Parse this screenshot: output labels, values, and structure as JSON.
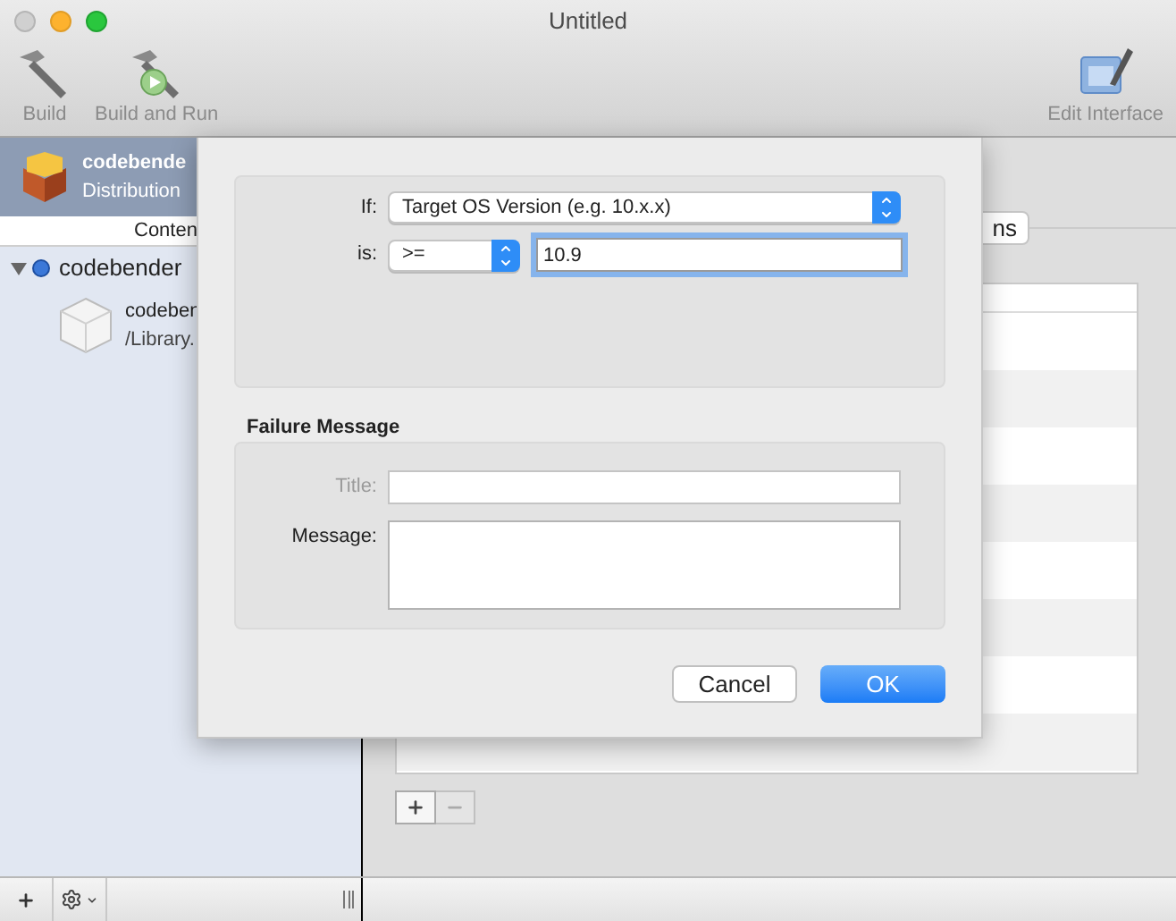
{
  "window": {
    "title": "Untitled"
  },
  "toolbar": {
    "left_items": [
      {
        "label": "Build",
        "kind": "build"
      },
      {
        "label": "Build and Run",
        "kind": "run"
      }
    ],
    "right_items": [
      {
        "label": "Edit Interface",
        "kind": "interface"
      }
    ]
  },
  "sidebar": {
    "package": {
      "title": "codebende",
      "subtitle": "Distribution",
      "selected": true
    },
    "header": "Conten",
    "tree": [
      {
        "label": "codebender",
        "expanded": true,
        "children": [
          {
            "title": "codeben",
            "subtitle": "/Library."
          }
        ]
      }
    ]
  },
  "main": {
    "tab_label": "ns"
  },
  "sheet": {
    "if_label": "If:",
    "if_value": "Target OS Version (e.g. 10.x.x)",
    "is_label": "is:",
    "operator": ">=",
    "version": "10.9",
    "failure_heading": "Failure Message",
    "fields": [
      {
        "label": "Title:",
        "kind": "line",
        "disabled": true
      },
      {
        "label": "Message:",
        "kind": "area",
        "disabled": false
      }
    ],
    "buttons": [
      {
        "label": "Cancel",
        "default": false
      },
      {
        "label": "OK",
        "default": true
      }
    ]
  }
}
